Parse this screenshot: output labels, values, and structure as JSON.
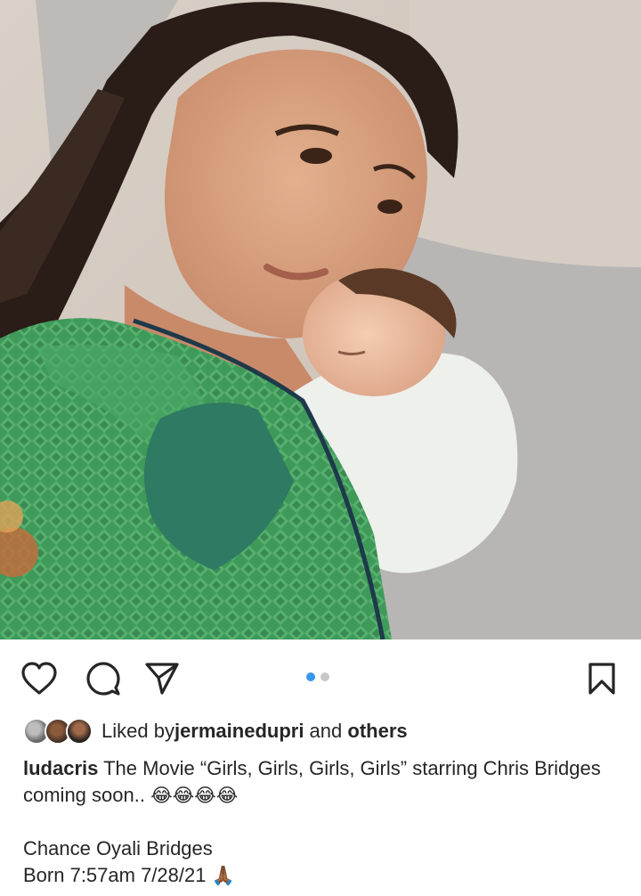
{
  "post": {
    "photo_alt": "",
    "carousel": {
      "count": 2,
      "active_index": 0
    },
    "icons": {
      "like": "heart-icon",
      "comment": "comment-icon",
      "share": "paper-plane-icon",
      "save": "bookmark-icon"
    },
    "likes": {
      "prefix": "Liked by ",
      "user": "jermainedupri",
      "connector": " and ",
      "others": "others"
    },
    "caption": {
      "username": "ludacris",
      "line1": " The Movie “Girls, Girls, Girls, Girls” starring Chris Bridges coming soon.. ",
      "emoji1": "😂😂😂😂",
      "line2": "Chance Oyali Bridges",
      "line3": "Born 7:57am 7/28/21 ",
      "emoji2": "🙏🏾"
    },
    "colors": {
      "accent_dot": "#3897f0",
      "inactive_dot": "#c7c7c7",
      "text": "#262626"
    }
  }
}
